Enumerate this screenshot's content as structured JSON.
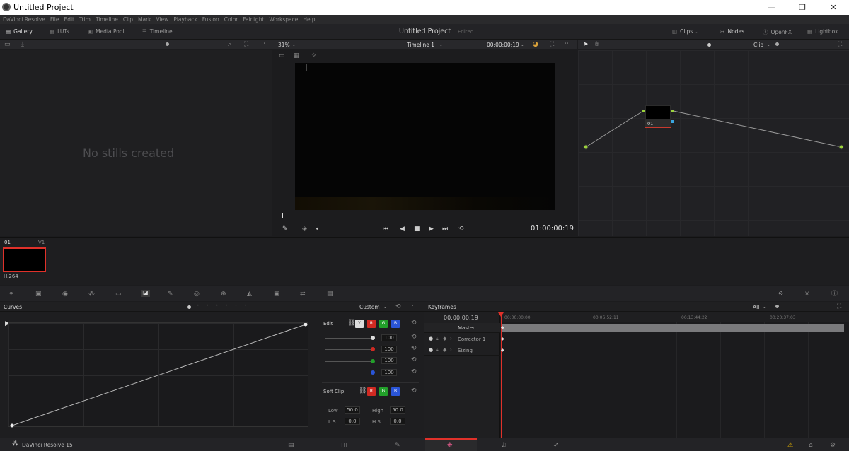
{
  "window": {
    "title": "Untitled Project",
    "minimize": "—",
    "maximize": "❐",
    "close": "✕"
  },
  "menu": [
    "DaVinci Resolve",
    "File",
    "Edit",
    "Trim",
    "Timeline",
    "Clip",
    "Mark",
    "View",
    "Playback",
    "Fusion",
    "Color",
    "Fairlight",
    "Workspace",
    "Help"
  ],
  "toolbar": {
    "gallery": "Gallery",
    "luts": "LUTs",
    "media_pool": "Media Pool",
    "timeline": "Timeline",
    "project_title": "Untitled Project",
    "edited": "Edited",
    "clips": "Clips",
    "nodes": "Nodes",
    "openfx": "OpenFX",
    "lightbox": "Lightbox"
  },
  "gallery": {
    "empty_text": "No stills created"
  },
  "viewer": {
    "zoom": "31%",
    "timeline_name": "Timeline 1",
    "source_timecode": "00:00:00:19",
    "timecode": "01:00:00:19"
  },
  "nodes": {
    "mode": "Clip",
    "node_label": "01"
  },
  "clip": {
    "index": "01",
    "track": "V1",
    "codec": "H.264"
  },
  "curves": {
    "title": "Curves",
    "preset": "Custom"
  },
  "edit": {
    "label": "Edit",
    "ch_y": "Y",
    "ch_r": "R",
    "ch_g": "G",
    "ch_b": "B",
    "values": [
      "100",
      "100",
      "100",
      "100"
    ],
    "soft_clip": "Soft Clip",
    "low_label": "Low",
    "low": "50.0",
    "high_label": "High",
    "high": "50.0",
    "ls_label": "L.S.",
    "ls": "0.0",
    "hs_label": "H.S.",
    "hs": "0.0"
  },
  "keyframes": {
    "title": "Keyframes",
    "filter": "All",
    "timecode": "00:00:00:19",
    "ruler": [
      "00:00:00:00",
      "00:06:52:11",
      "00:13:44:22",
      "00:20:37:03"
    ],
    "rows": [
      "Master",
      "Corrector 1",
      "Sizing"
    ]
  },
  "pagebar": {
    "app": "DaVinci Resolve 15"
  },
  "colors": {
    "accent_red": "#e0312a",
    "bg": "#1c1c1e"
  }
}
